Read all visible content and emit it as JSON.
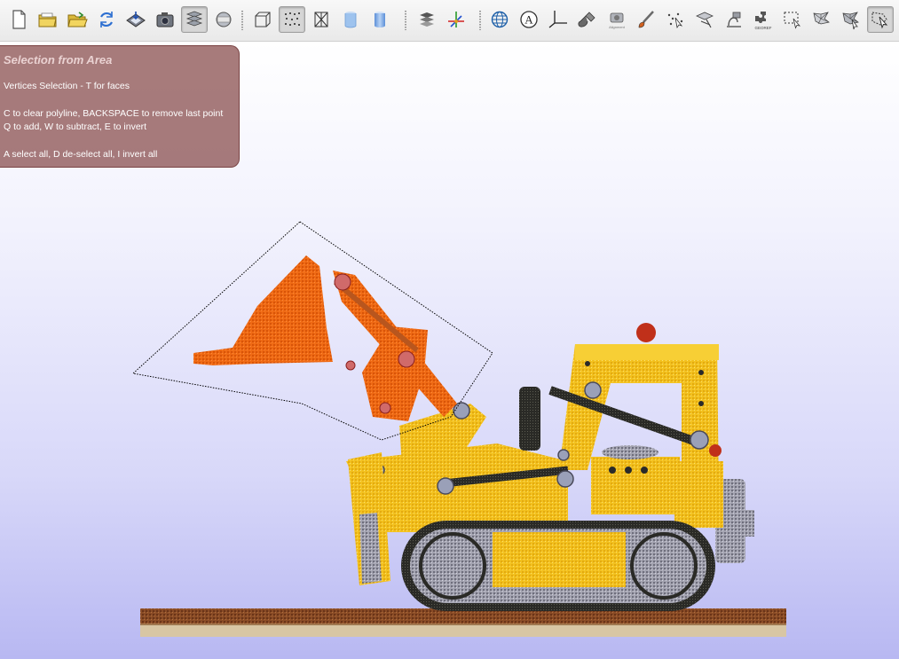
{
  "toolbar": {
    "items": [
      {
        "id": "new",
        "icon": "new-document-icon",
        "tooltip": "New"
      },
      {
        "id": "open-project",
        "icon": "open-project-icon",
        "tooltip": "Open project"
      },
      {
        "id": "open",
        "icon": "open-folder-icon",
        "tooltip": "Import mesh"
      },
      {
        "id": "reload",
        "icon": "reload-icon",
        "tooltip": "Reload"
      },
      {
        "id": "save",
        "icon": "save-icon",
        "tooltip": "Export mesh"
      },
      {
        "id": "snapshot",
        "icon": "camera-icon",
        "tooltip": "Save snapshot"
      },
      {
        "id": "layers",
        "icon": "layers-icon",
        "tooltip": "Show layer dialog",
        "active": true
      },
      {
        "id": "raster",
        "icon": "raster-sphere-icon",
        "tooltip": "Show raster dialog"
      },
      {
        "id": "bbox",
        "icon": "bounding-box-icon",
        "tooltip": "Bounding box"
      },
      {
        "id": "points",
        "icon": "points-icon",
        "tooltip": "Points",
        "active": true
      },
      {
        "id": "wireframe",
        "icon": "wireframe-icon",
        "tooltip": "Wireframe"
      },
      {
        "id": "flat",
        "icon": "flat-shading-icon",
        "tooltip": "Flat"
      },
      {
        "id": "smooth",
        "icon": "smooth-shading-icon",
        "tooltip": "Smooth"
      },
      {
        "id": "lighting",
        "icon": "lighting-icon",
        "tooltip": "Lighting"
      },
      {
        "id": "axes",
        "icon": "axes-icon",
        "tooltip": "Trackball"
      },
      {
        "id": "globe",
        "icon": "globe-icon",
        "tooltip": "Info"
      },
      {
        "id": "annotation",
        "icon": "annotation-a-icon",
        "tooltip": "Annotation"
      },
      {
        "id": "measure",
        "icon": "measure-angle-icon",
        "tooltip": "Measuring tool"
      },
      {
        "id": "brush",
        "icon": "brush-icon",
        "tooltip": "Z-painting"
      },
      {
        "id": "align",
        "icon": "align-icon",
        "tooltip": "Align"
      },
      {
        "id": "paint",
        "icon": "paint-brush-icon",
        "tooltip": "Paint"
      },
      {
        "id": "pickpoints",
        "icon": "pick-points-icon",
        "tooltip": "Pick points"
      },
      {
        "id": "manipulator",
        "icon": "manipulator-icon",
        "tooltip": "Manipulators"
      },
      {
        "id": "raster-align",
        "icon": "raster-align-icon",
        "tooltip": "Raster alignment"
      },
      {
        "id": "georef",
        "icon": "georef-icon",
        "tooltip": "Georeferencing"
      },
      {
        "id": "select-rect",
        "icon": "select-rectangle-icon",
        "tooltip": "Select faces in rectangle"
      },
      {
        "id": "select-conn",
        "icon": "select-connected-icon",
        "tooltip": "Select connected components"
      },
      {
        "id": "select-vert",
        "icon": "select-vertices-icon",
        "tooltip": "Select vertices"
      },
      {
        "id": "select-area",
        "icon": "select-area-icon",
        "tooltip": "Select faces/vertices inside polyline area",
        "active": true
      }
    ],
    "micro_labels": {
      "raster_align": "Alignment",
      "georef": "GEOREF"
    }
  },
  "help_panel": {
    "title": "Selection from Area",
    "lines": [
      "Vertices Selection - T for faces",
      "C to clear polyline, BACKSPACE to remove last point",
      "Q to add, W to subtract, E to invert",
      "A select all, D de-select all, I invert all"
    ]
  },
  "colors": {
    "background_top": "#ffffff",
    "background_bottom": "#b8b8f2",
    "help_panel_bg": "#8e5656",
    "help_title": "#ead2d2",
    "selection_polyline": "#000000",
    "model_yellow": "#f3c11e",
    "model_selected_orange": "#ef6a14",
    "model_tracks_gray": "#9a9aa6",
    "base_brown": "#8a4c26"
  },
  "viewport": {
    "content": "point-cloud-model-bulldozer",
    "render_mode": "points",
    "selection_mode": "vertices"
  }
}
